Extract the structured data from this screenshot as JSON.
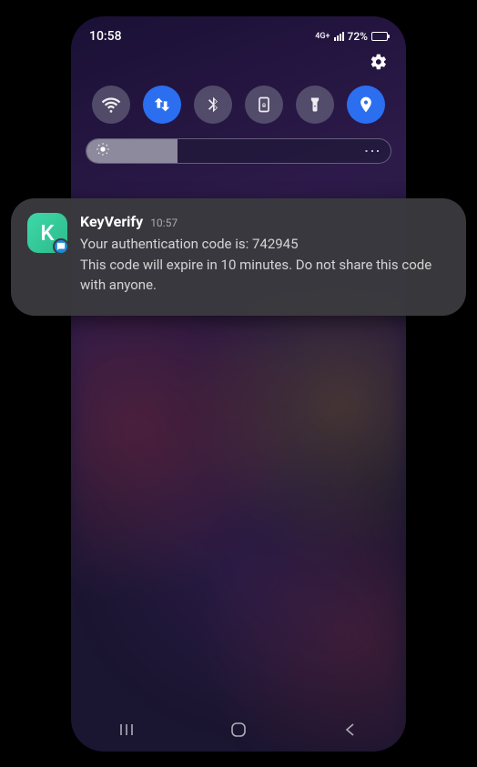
{
  "status": {
    "time": "10:58",
    "network": "4G+",
    "battery_pct": "72%",
    "battery_fill_pct": 72
  },
  "quick_settings": {
    "toggles": [
      {
        "name": "wifi",
        "active": false
      },
      {
        "name": "data",
        "active": true
      },
      {
        "name": "bluetooth",
        "active": false
      },
      {
        "name": "lock-rotation",
        "active": false
      },
      {
        "name": "flashlight",
        "active": false
      },
      {
        "name": "location",
        "active": true
      }
    ],
    "brightness_pct": 30
  },
  "notification": {
    "app_name": "KeyVerify",
    "app_letter": "K",
    "time": "10:57",
    "line1": "Your authentication code is: 742945",
    "line2": "This code will expire in 10 minutes. Do not share this code with anyone."
  }
}
